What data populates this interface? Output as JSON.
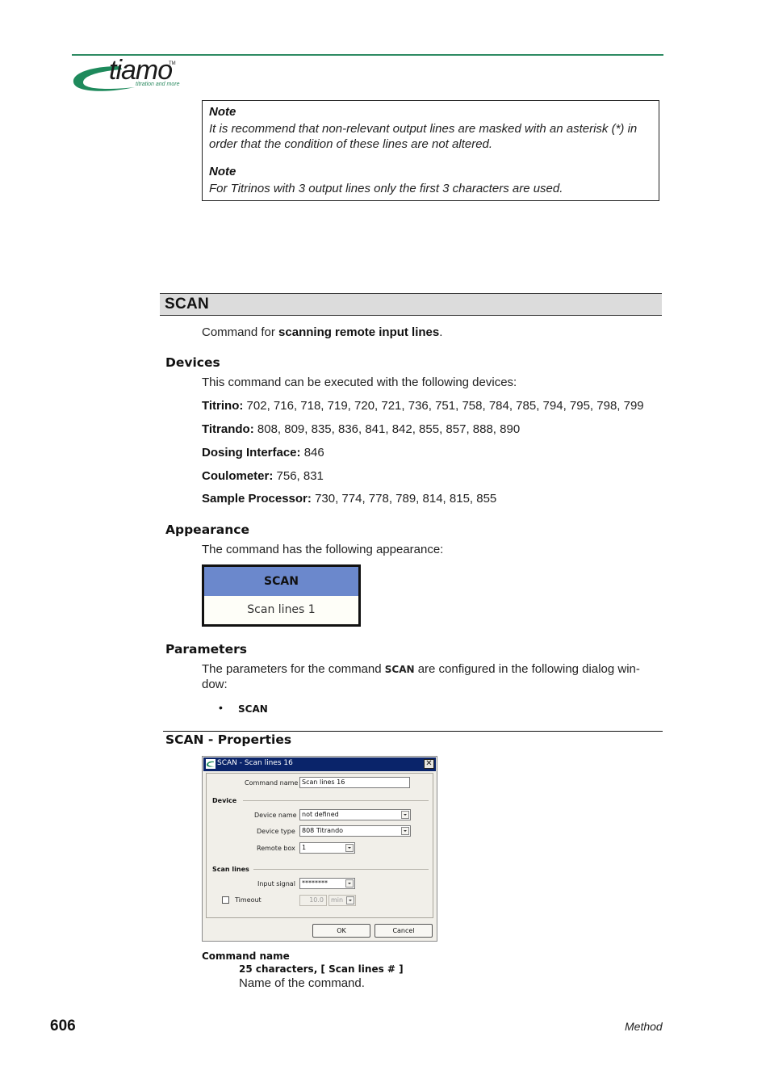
{
  "header": {
    "logo_word": "tiamo",
    "logo_tm": "TM",
    "logo_tagline": "titration and more",
    "brand_color": "#2e8b62"
  },
  "notes": [
    {
      "title": "Note",
      "text_line1": "It is recommend that non-relevant output lines are masked with an asterisk (*) in",
      "text_line2": "order that the condition of these lines are not altered."
    },
    {
      "title": "Note",
      "text": "For Titrinos with 3 output lines only the first 3 characters are used."
    }
  ],
  "section": {
    "title": "SCAN",
    "intro_prefix": "Command for ",
    "intro_bold": "scanning remote input lines",
    "intro_suffix": "."
  },
  "devices": {
    "heading": "Devices",
    "intro": "This command can be executed with the following devices:",
    "items": [
      {
        "label": "Titrino:",
        "values": " 702, 716, 718, 719, 720, 721, 736, 751, 758, 784, 785, 794, 795, 798, 799"
      },
      {
        "label": "Titrando:",
        "values": " 808, 809, 835, 836, 841, 842, 855, 857, 888, 890"
      },
      {
        "label": "Dosing Interface:",
        "values": " 846"
      },
      {
        "label": "Coulometer:",
        "values": " 756, 831"
      },
      {
        "label": "Sample Processor:",
        "values": " 730, 774, 778, 789, 814, 815, 855"
      }
    ]
  },
  "appearance": {
    "heading": "Appearance",
    "intro": "The command has the following appearance:",
    "block_title": "SCAN",
    "block_body": "Scan lines 1",
    "block_header_color": "#6b88cc"
  },
  "parameters": {
    "heading": "Parameters",
    "text_prefix": "The parameters for the command ",
    "text_cmd": "SCAN",
    "text_suffix": " are configured in the following dialog win-",
    "text_line2": "dow:",
    "bullet": "SCAN"
  },
  "properties": {
    "heading": "SCAN - Properties",
    "dialog": {
      "title": "SCAN - Scan lines 16",
      "close_glyph": "✕",
      "command_name_label": "Command name",
      "command_name_value": "Scan lines 16",
      "device_group": "Device",
      "device_name_label": "Device name",
      "device_name_value": "not defined",
      "device_type_label": "Device type",
      "device_type_value": "808 Titrando",
      "remote_box_label": "Remote box",
      "remote_box_value": "1",
      "scan_lines_group": "Scan lines",
      "input_signal_label": "Input signal",
      "input_signal_value": "********",
      "timeout_label": "Timeout",
      "timeout_checked": false,
      "timeout_value": "10.0",
      "timeout_unit": "min",
      "ok_label": "OK",
      "cancel_label": "Cancel"
    },
    "param_name": "Command name",
    "param_spec": "25 characters, [ Scan lines # ]",
    "param_desc": "Name of the command."
  },
  "footer": {
    "page_number": "606",
    "chapter": "Method"
  }
}
